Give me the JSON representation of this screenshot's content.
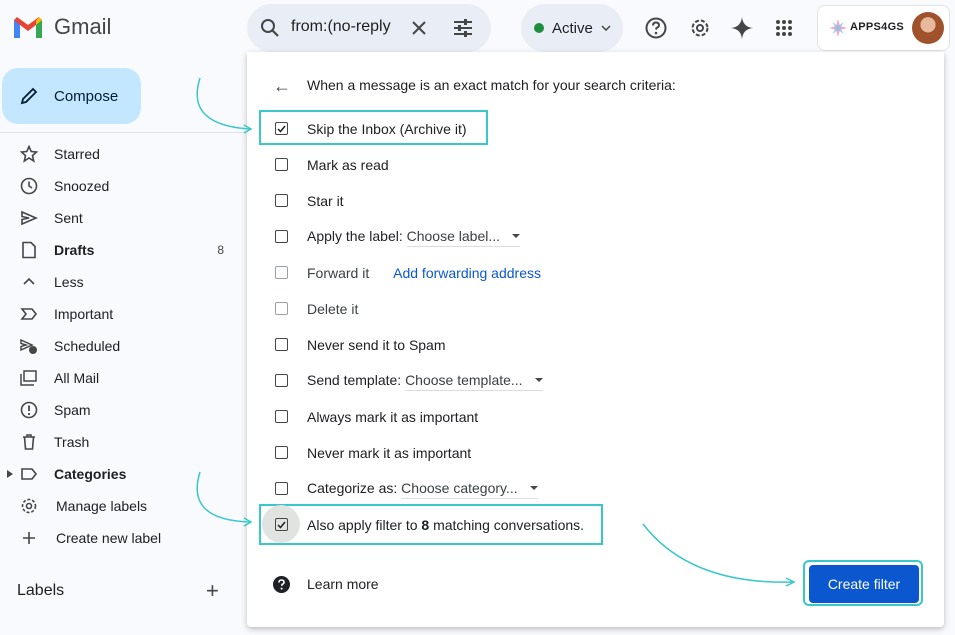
{
  "header": {
    "app_name": "Gmail",
    "search_query": "from:(no-reply",
    "status_label": "Active",
    "account_brand": "APPS4GS"
  },
  "sidebar": {
    "compose_label": "Compose",
    "items": [
      {
        "label": "Starred",
        "icon": "star-icon",
        "count": ""
      },
      {
        "label": "Snoozed",
        "icon": "clock-icon",
        "count": ""
      },
      {
        "label": "Sent",
        "icon": "send-icon",
        "count": ""
      },
      {
        "label": "Drafts",
        "icon": "draft-icon",
        "count": "8"
      },
      {
        "label": "Less",
        "icon": "chevron-up-icon",
        "count": ""
      },
      {
        "label": "Important",
        "icon": "important-icon",
        "count": ""
      },
      {
        "label": "Scheduled",
        "icon": "scheduled-icon",
        "count": ""
      },
      {
        "label": "All Mail",
        "icon": "all-mail-icon",
        "count": ""
      },
      {
        "label": "Spam",
        "icon": "spam-icon",
        "count": ""
      },
      {
        "label": "Trash",
        "icon": "trash-icon",
        "count": ""
      },
      {
        "label": "Categories",
        "icon": "label-icon",
        "count": ""
      },
      {
        "label": "Manage labels",
        "icon": "gear-icon",
        "count": ""
      },
      {
        "label": "Create new label",
        "icon": "plus-icon",
        "count": ""
      }
    ],
    "labels_heading": "Labels"
  },
  "filter": {
    "criteria_text": "When a message is an exact match for your search criteria:",
    "options": {
      "skip_inbox": {
        "label": "Skip the Inbox (Archive it)",
        "checked": true
      },
      "mark_read": {
        "label": "Mark as read",
        "checked": false
      },
      "star_it": {
        "label": "Star it",
        "checked": false
      },
      "apply_label": {
        "label": "Apply the label:",
        "dropdown": "Choose label...",
        "checked": false
      },
      "forward_it": {
        "label": "Forward it",
        "link": "Add forwarding address",
        "checked": false
      },
      "delete_it": {
        "label": "Delete it",
        "checked": false
      },
      "never_spam": {
        "label": "Never send it to Spam",
        "checked": false
      },
      "send_template": {
        "label": "Send template:",
        "dropdown": "Choose template...",
        "checked": false
      },
      "always_important": {
        "label": "Always mark it as important",
        "checked": false
      },
      "never_important": {
        "label": "Never mark it as important",
        "checked": false
      },
      "categorize": {
        "label": "Categorize as:",
        "dropdown": "Choose category...",
        "checked": false
      },
      "also_apply": {
        "prefix": "Also apply filter to ",
        "count": "8",
        "suffix": " matching conversations.",
        "checked": true
      }
    },
    "learn_more": "Learn more",
    "create_button": "Create filter"
  },
  "colors": {
    "accent": "#0b57d0",
    "compose_bg": "#c2e7ff",
    "highlight": "#3ac7c9",
    "status_dot": "#1e8e3e"
  }
}
